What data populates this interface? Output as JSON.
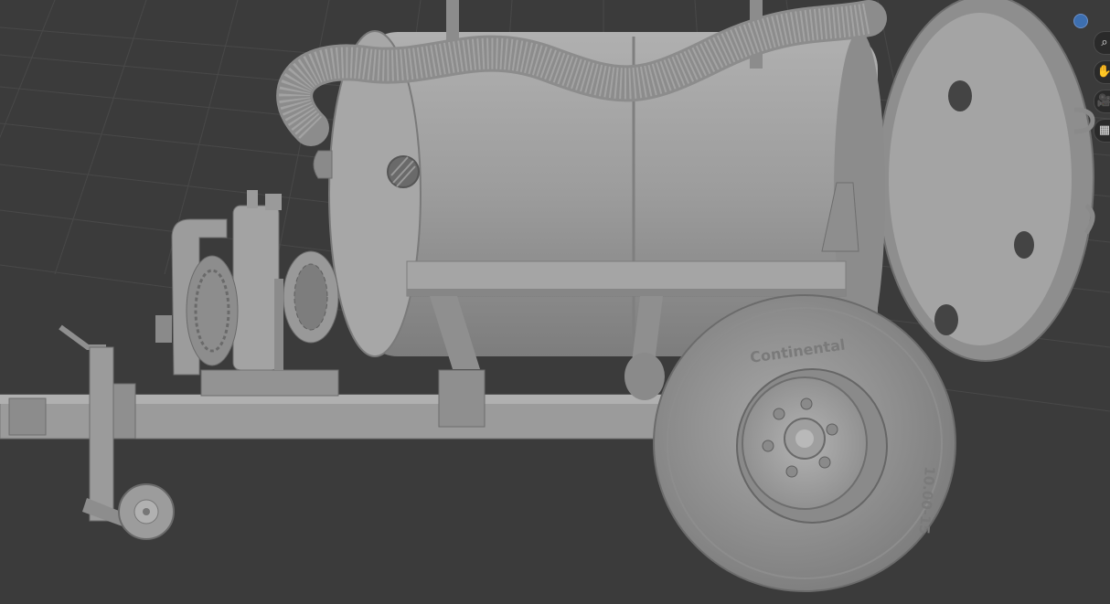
{
  "viewport": {
    "background": "#3b3b3b",
    "grid_color": "#555555",
    "model_color": "#9a9a9a"
  },
  "tire": {
    "brand_text": "Continental",
    "size_text": "10.00-15"
  },
  "gizmo": {
    "axis_color": "#3d6fb0"
  },
  "navigation": {
    "zoom": {
      "icon": "magnify-icon",
      "glyph": "⌕"
    },
    "pan": {
      "icon": "hand-icon",
      "glyph": "✋"
    },
    "camera": {
      "icon": "camera-icon",
      "glyph": "🎥"
    },
    "ortho": {
      "icon": "grid-icon",
      "glyph": "▦"
    }
  }
}
